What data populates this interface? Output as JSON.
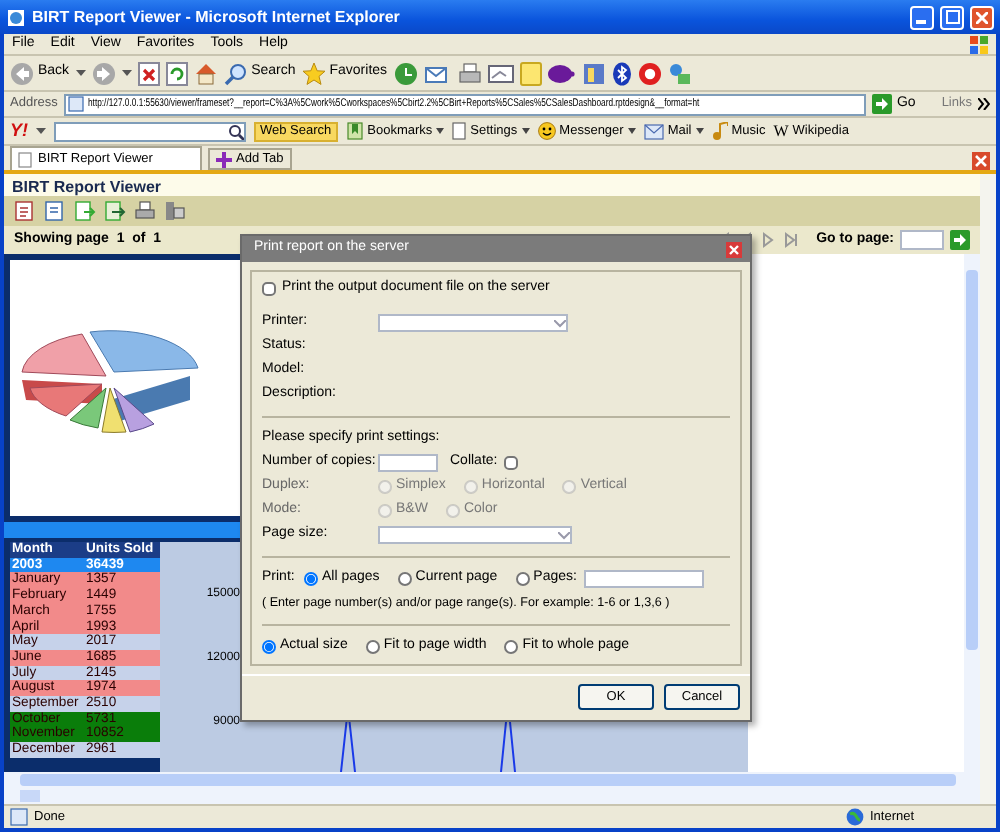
{
  "window": {
    "title": "BIRT Report Viewer - Microsoft Internet Explorer"
  },
  "menu": [
    "File",
    "Edit",
    "View",
    "Favorites",
    "Tools",
    "Help"
  ],
  "toolbar": {
    "back": "Back",
    "search": "Search",
    "favorites": "Favorites"
  },
  "address": {
    "label": "Address",
    "url": "http://127.0.0.1:55630/viewer/frameset?__report=C%3A%5Cwork%5Cworkspaces%5Cbirt2.2%5CBirt+Reports%5CSales%5CSalesDashboard.rptdesign&__format=ht",
    "go": "Go",
    "links": "Links"
  },
  "yahoo_toolbar": {
    "logo": "Y!",
    "search_button": "Web Search",
    "items": [
      {
        "kind": "bookmarks",
        "label": "Bookmarks"
      },
      {
        "kind": "settings",
        "label": "Settings"
      },
      {
        "kind": "messenger",
        "label": "Messenger"
      },
      {
        "kind": "mail",
        "label": "Mail"
      },
      {
        "kind": "music",
        "label": "Music"
      },
      {
        "kind": "wiki",
        "mark": "W",
        "label": "Wikipedia"
      }
    ]
  },
  "tabs": [
    {
      "label": "BIRT Report Viewer",
      "selected": true
    }
  ],
  "add_tab": "Add Tab",
  "viewer": {
    "title": "BIRT Report Viewer",
    "page_status": "Showing page  1  of  1",
    "go_to_page": "Go to page:"
  },
  "report": {
    "table": {
      "columns": [
        "Month",
        "Units Sold"
      ],
      "total": {
        "month": "2003",
        "units": "36439"
      },
      "rows": [
        {
          "month": "January",
          "units": "1357",
          "color": "#f28a8a"
        },
        {
          "month": "February",
          "units": "1449",
          "color": "#f28a8a"
        },
        {
          "month": "March",
          "units": "1755",
          "color": "#f28a8a"
        },
        {
          "month": "April",
          "units": "1993",
          "color": "#f28a8a"
        },
        {
          "month": "May",
          "units": "2017",
          "color": "#c6d2ea"
        },
        {
          "month": "June",
          "units": "1685",
          "color": "#f28a8a"
        },
        {
          "month": "July",
          "units": "2145",
          "color": "#c6d2ea"
        },
        {
          "month": "August",
          "units": "1974",
          "color": "#f28a8a"
        },
        {
          "month": "September",
          "units": "2510",
          "color": "#c6d2ea"
        },
        {
          "month": "October",
          "units": "5731",
          "color": "#0a7d0a"
        },
        {
          "month": "November",
          "units": "10852",
          "color": "#0a7d0a"
        },
        {
          "month": "December",
          "units": "2961",
          "color": "#c6d2ea"
        }
      ]
    },
    "axis_labels": [
      "15000",
      "12000",
      "9000"
    ]
  },
  "dialog": {
    "title": "Print report on the server",
    "print_on_server": {
      "label": "Print the output document file on the server",
      "checked": false
    },
    "printer": {
      "label": "Printer:"
    },
    "info_labels": [
      "Status:",
      "Model:",
      "Description:"
    ],
    "settings_heading": "Please specify print settings:",
    "copies": {
      "label": "Number of copies:"
    },
    "collate": {
      "label": "Collate:",
      "checked": false
    },
    "duplex": {
      "label": "Duplex:",
      "disabled": true,
      "options": [
        {
          "label": "Simplex",
          "selected": false
        },
        {
          "label": "Horizontal",
          "selected": false
        },
        {
          "label": "Vertical",
          "selected": false
        }
      ]
    },
    "mode": {
      "label": "Mode:",
      "disabled": true,
      "options": [
        {
          "label": "B&W",
          "selected": false
        },
        {
          "label": "Color",
          "selected": false
        }
      ]
    },
    "page_size": {
      "label": "Page size:"
    },
    "print_range": {
      "label": "Print:",
      "options": [
        {
          "label": "All pages",
          "selected": true
        },
        {
          "label": "Current page",
          "selected": false
        },
        {
          "label": "Pages:",
          "selected": false
        }
      ],
      "hint": "( Enter page number(s) and/or page range(s). For example: 1-6 or 1,3,6 )"
    },
    "fit": {
      "options": [
        {
          "label": "Actual size",
          "selected": true
        },
        {
          "label": "Fit to page width",
          "selected": false
        },
        {
          "label": "Fit to whole page",
          "selected": false
        }
      ]
    },
    "buttons": [
      "OK",
      "Cancel"
    ]
  },
  "status_bar": {
    "text": "Done",
    "zone": "Internet"
  }
}
